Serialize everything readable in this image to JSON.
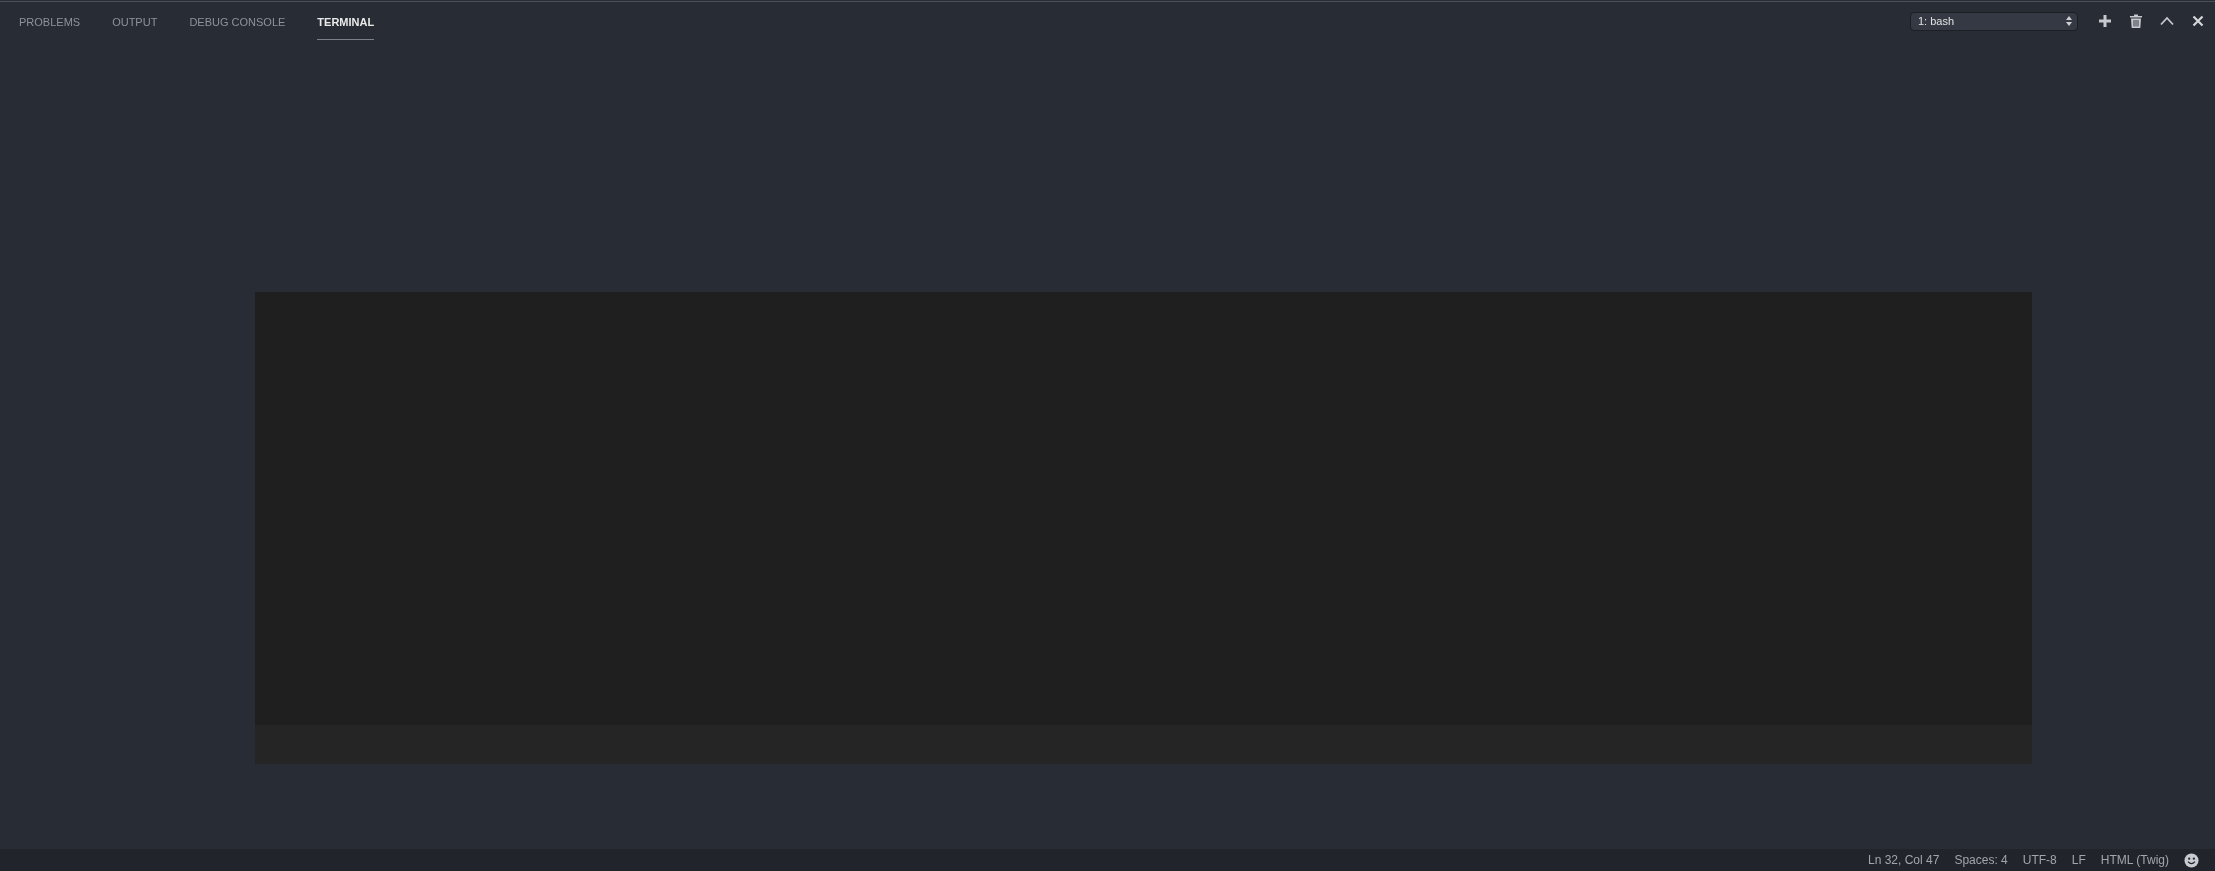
{
  "tabs": [
    {
      "label": "PROBLEMS",
      "selected": false
    },
    {
      "label": "OUTPUT",
      "selected": false
    },
    {
      "label": "DEBUG CONSOLE",
      "selected": false
    },
    {
      "label": "TERMINAL",
      "selected": true
    }
  ],
  "terminal_select": {
    "value": "1: bash"
  },
  "status_bar": {
    "items": [
      "Ln 32, Col 47",
      "Spaces: 4",
      "UTF-8",
      "LF",
      "HTML (Twig)"
    ]
  }
}
